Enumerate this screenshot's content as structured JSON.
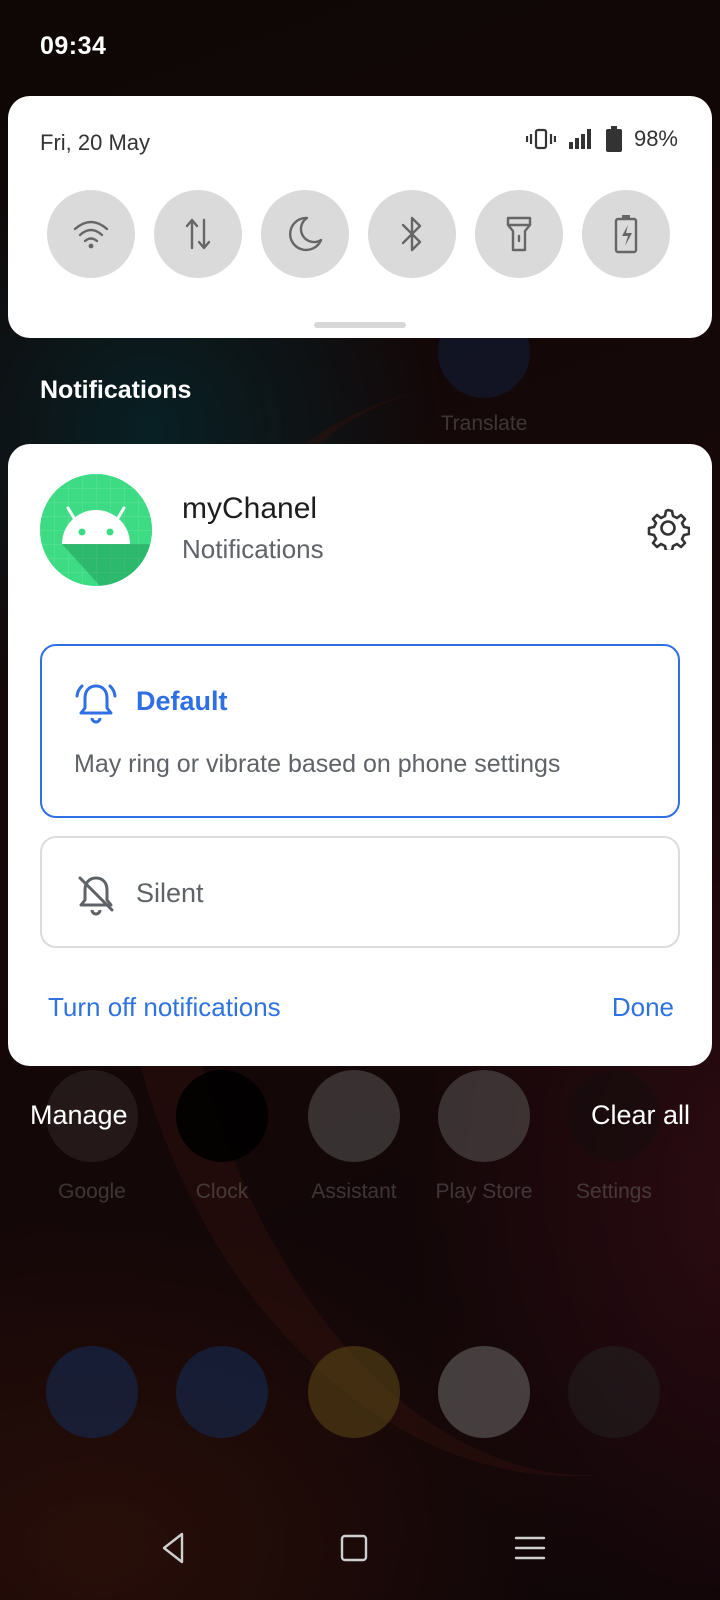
{
  "status_bar": {
    "time": "09:34"
  },
  "quick_settings": {
    "date": "Fri, 20 May",
    "battery": "98%",
    "tiles": [
      "wifi-icon",
      "mobile-data-icon",
      "do-not-disturb-icon",
      "bluetooth-icon",
      "flashlight-icon",
      "battery-saver-icon"
    ]
  },
  "notifications_header": "Notifications",
  "background_home": {
    "translate_label": "Translate",
    "apps": [
      {
        "label": "Google"
      },
      {
        "label": "Clock"
      },
      {
        "label": "Assistant"
      },
      {
        "label": "Play Store"
      },
      {
        "label": "Settings"
      }
    ]
  },
  "notification_card": {
    "app_name": "myChanel",
    "subtitle": "Notifications",
    "options": {
      "default_label": "Default",
      "default_desc": "May ring or vibrate based on phone settings",
      "silent_label": "Silent"
    },
    "turn_off": "Turn off notifications",
    "done": "Done"
  },
  "actions": {
    "manage": "Manage",
    "clear_all": "Clear all"
  },
  "colors": {
    "accent": "#2f6fe4",
    "android_green": "#3ddc84"
  }
}
